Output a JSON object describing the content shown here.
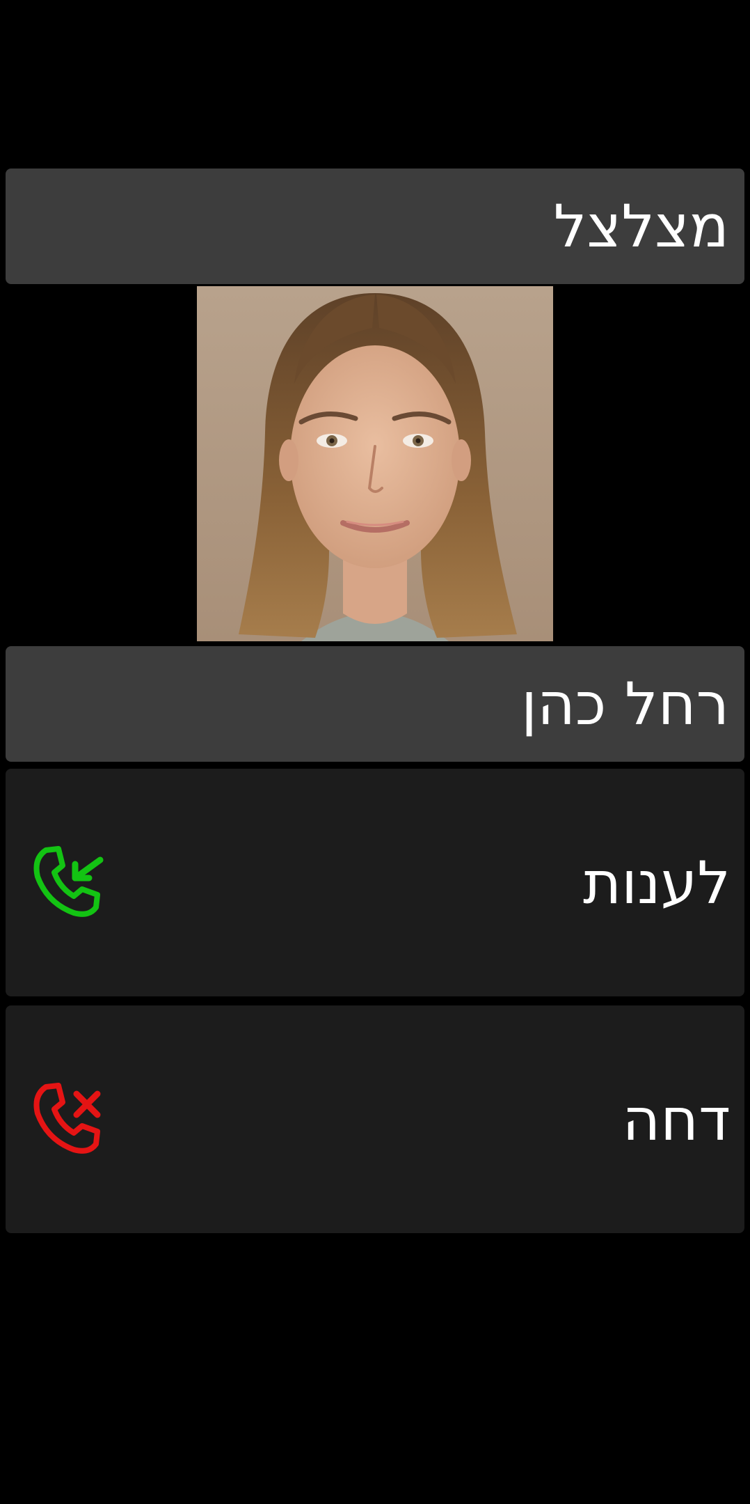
{
  "call": {
    "status_label": "מצלצל",
    "caller_name": "רחל כהן"
  },
  "actions": {
    "answer_label": "לענות",
    "decline_label": "דחה"
  },
  "icons": {
    "avatar": "caller-photo",
    "answer": "phone-incoming-icon",
    "decline": "phone-decline-icon"
  },
  "colors": {
    "background": "#000000",
    "bar": "#3d3d3d",
    "button": "#1c1c1c",
    "text": "#ffffff",
    "answer": "#13c313",
    "decline": "#e51414"
  }
}
